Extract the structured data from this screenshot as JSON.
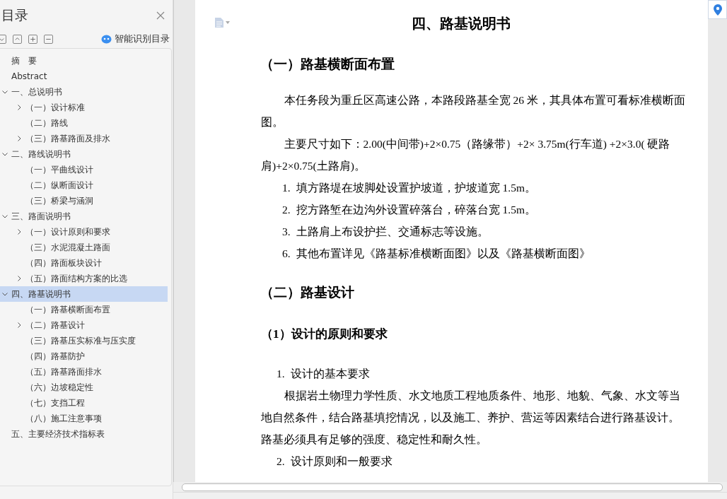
{
  "sidebar": {
    "title": "目录",
    "smart_button": "智能识别目录",
    "toc": [
      {
        "label": "摘　要",
        "selected": false
      },
      {
        "label": "Abstract",
        "selected": false
      },
      {
        "label": "一、总说明书",
        "selected": false,
        "expanded": true,
        "children": [
          {
            "label": "（一）设计标准",
            "selected": false,
            "expanded": false
          },
          {
            "label": "（二）路线",
            "selected": false
          },
          {
            "label": "（三）路基路面及排水",
            "selected": false,
            "expanded": false
          }
        ]
      },
      {
        "label": "二、路线说明书",
        "selected": false,
        "expanded": true,
        "children": [
          {
            "label": "（一）平曲线设计",
            "selected": false
          },
          {
            "label": "（二）纵断面设计",
            "selected": false
          },
          {
            "label": "（三）桥梁与涵洞",
            "selected": false
          }
        ]
      },
      {
        "label": "三、路面说明书",
        "selected": false,
        "expanded": true,
        "children": [
          {
            "label": "（一）设计原则和要求",
            "selected": false,
            "expanded": false
          },
          {
            "label": "（三）水泥混凝土路面",
            "selected": false
          },
          {
            "label": "（四）路面板块设计",
            "selected": false
          },
          {
            "label": "（五）路面结构方案的比选",
            "selected": false,
            "expanded": false
          }
        ]
      },
      {
        "label": "四、路基说明书",
        "selected": true,
        "expanded": true,
        "children": [
          {
            "label": "（一）路基横断面布置",
            "selected": false
          },
          {
            "label": "（二）路基设计",
            "selected": false,
            "expanded": false
          },
          {
            "label": "（三）路基压实标准与压实度",
            "selected": false
          },
          {
            "label": "（四）路基防护",
            "selected": false
          },
          {
            "label": "（五）路基路面排水",
            "selected": false
          },
          {
            "label": "（六）边坡稳定性",
            "selected": false
          },
          {
            "label": "（七）支挡工程",
            "selected": false
          },
          {
            "label": "（八）施工注意事项",
            "selected": false
          }
        ]
      },
      {
        "label": "五、主要经济技术指标表",
        "selected": false
      }
    ]
  },
  "document": {
    "blocks": [
      {
        "kind": "title",
        "text": "四、路基说明书"
      },
      {
        "kind": "h1",
        "text": "（一）路基横断面布置"
      },
      {
        "kind": "para",
        "text": "本任务段为重丘区高速公路，本路段路基全宽 26 米，其具体布置可看标准横断面图。"
      },
      {
        "kind": "para",
        "text": "主要尺寸如下：2.00(中间带)+2×0.75（路缘带）+2× 3.75m(行车道) +2×3.0( 硬路肩)+2×0.75(土路肩)。"
      },
      {
        "kind": "item",
        "number": "1.",
        "text": "填方路堤在坡脚处设置护坡道，护坡道宽 1.5m。"
      },
      {
        "kind": "item",
        "number": "2.",
        "text": "挖方路堑在边沟外设置碎落台，碎落台宽 1.5m。"
      },
      {
        "kind": "item",
        "number": "3.",
        "text": "土路肩上布设护拦、交通标志等设施。"
      },
      {
        "kind": "item",
        "number": "6.",
        "text": "其他布置详见《路基标准横断面图》以及《路基横断面图》"
      },
      {
        "kind": "h1",
        "text": "（二）路基设计"
      },
      {
        "kind": "h2",
        "text": "（1）设计的原则和要求"
      },
      {
        "kind": "subitem",
        "number": "1.",
        "text": "设计的基本要求"
      },
      {
        "kind": "para",
        "text": "根据岩土物理力学性质、水文地质工程地质条件、地形、地貌、气象、水文等当地自然条件，结合路基填挖情况，以及施工、养护、营运等因素结合进行路基设计。路基必须具有足够的强度、稳定性和耐久性。"
      },
      {
        "kind": "subitem",
        "number": "2.",
        "text": "设计原则和一般要求"
      }
    ]
  }
}
